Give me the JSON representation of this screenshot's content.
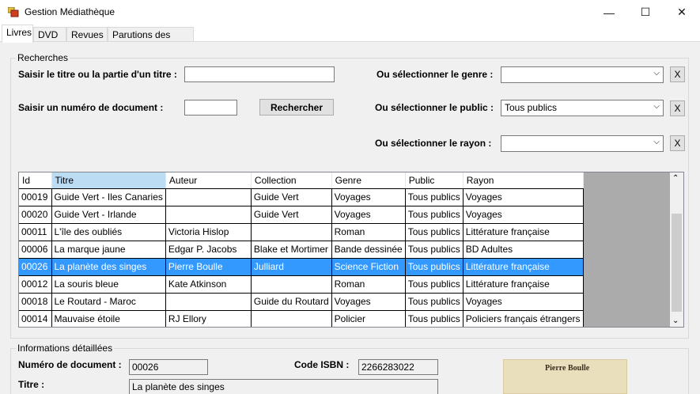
{
  "window": {
    "title": "Gestion Médiathèque",
    "minimize_glyph": "—",
    "maximize_glyph": "☐",
    "close_glyph": "✕"
  },
  "tabs": [
    "Livres",
    "DVD",
    "Revues",
    "Parutions des revues"
  ],
  "recherches": {
    "group_title": "Recherches",
    "titre_label": "Saisir le titre ou la partie d'un titre :",
    "titre_value": "",
    "numero_label": "Saisir un numéro de document :",
    "numero_value": "",
    "rechercher_button": "Rechercher",
    "genre_label": "Ou sélectionner le genre :",
    "genre_value": "",
    "public_label": "Ou sélectionner le public :",
    "public_value": "Tous publics",
    "rayon_label": "Ou sélectionner le rayon :",
    "rayon_value": "",
    "clear_label": "X"
  },
  "table": {
    "columns": [
      "Id",
      "Titre",
      "Auteur",
      "Collection",
      "Genre",
      "Public",
      "Rayon"
    ],
    "rows": [
      [
        "00019",
        "Guide Vert - Iles Canaries",
        "",
        "Guide Vert",
        "Voyages",
        "Tous publics",
        "Voyages"
      ],
      [
        "00020",
        "Guide Vert - Irlande",
        "",
        "Guide Vert",
        "Voyages",
        "Tous publics",
        "Voyages"
      ],
      [
        "00011",
        "L'île des oubliés",
        "Victoria Hislop",
        "",
        "Roman",
        "Tous publics",
        "Littérature française"
      ],
      [
        "00006",
        "La marque jaune",
        "Edgar P. Jacobs",
        "Blake et Mortimer",
        "Bande dessinée",
        "Tous publics",
        "BD Adultes"
      ],
      [
        "00026",
        "La planète des singes",
        "Pierre Boulle",
        "Julliard",
        "Science Fiction",
        "Tous publics",
        "Littérature française"
      ],
      [
        "00012",
        "La souris bleue",
        "Kate Atkinson",
        "",
        "Roman",
        "Tous publics",
        "Littérature française"
      ],
      [
        "00018",
        "Le Routard - Maroc",
        "",
        "Guide du Routard",
        "Voyages",
        "Tous publics",
        "Voyages"
      ],
      [
        "00014",
        "Mauvaise étoile",
        "RJ Ellory",
        "",
        "Policier",
        "Tous publics",
        "Policiers français étrangers"
      ]
    ],
    "selected_row_index": 4,
    "sorted_column": "Titre"
  },
  "details": {
    "group_title": "Informations détaillées",
    "numero_label": "Numéro de document :",
    "numero_value": "00026",
    "isbn_label": "Code ISBN :",
    "isbn_value": "2266283022",
    "titre_label": "Titre :",
    "titre_value": "La planète des singes",
    "cover_author": "Pierre Boulle"
  },
  "colors": {
    "selection": "#3399ff",
    "sorted_header": "#bcdcf4",
    "form_background": "#f0f0f0"
  },
  "icons": {
    "app": "app-icon",
    "dropdown": "chevron-down-icon"
  }
}
